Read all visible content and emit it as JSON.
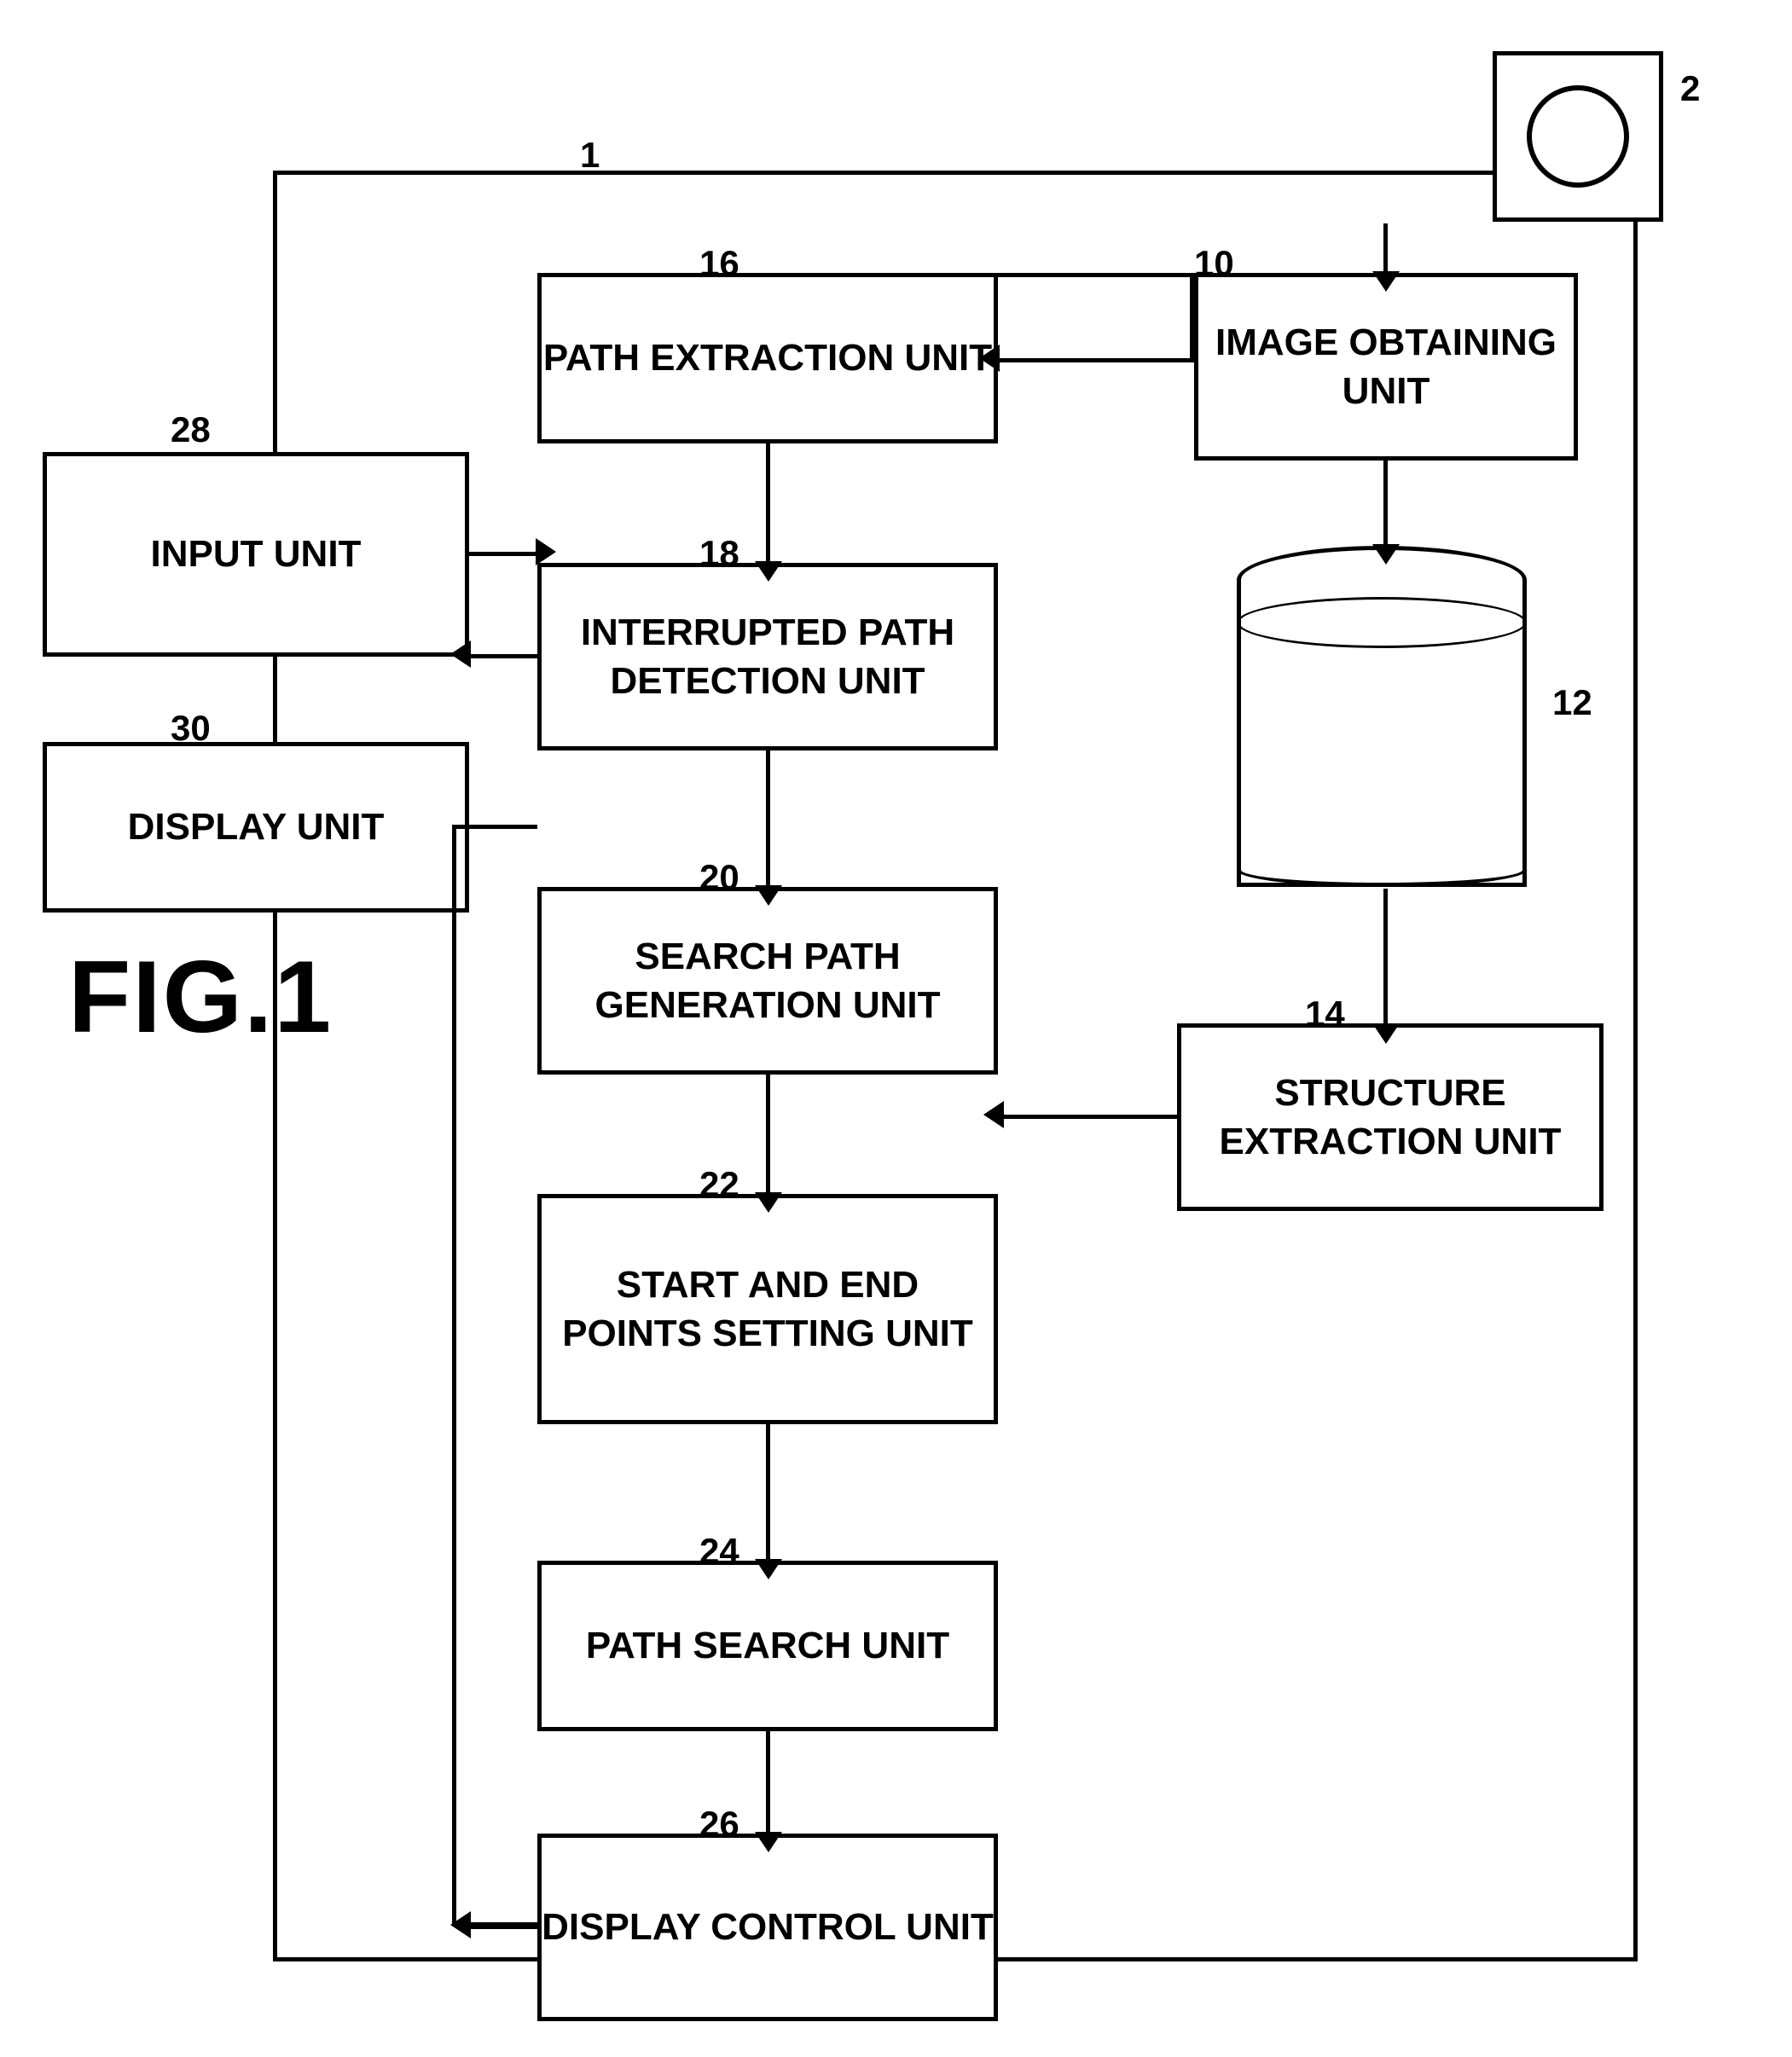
{
  "diagram": {
    "title": "FIG.1",
    "labels": {
      "camera": "2",
      "main_system": "1",
      "image_obtaining": "10",
      "database": "12",
      "structure_extraction": "14",
      "path_extraction": "16",
      "interrupted_path": "18",
      "search_path_gen": "20",
      "start_end_points": "22",
      "path_search": "24",
      "display_control": "26",
      "input_unit": "28",
      "display_unit": "30"
    },
    "blocks": {
      "input_unit": "INPUT UNIT",
      "display_unit": "DISPLAY UNIT",
      "image_obtaining": "IMAGE OBTAINING UNIT",
      "structure_extraction": "STRUCTURE EXTRACTION UNIT",
      "path_extraction": "PATH EXTRACTION UNIT",
      "interrupted_path": "INTERRUPTED PATH DETECTION UNIT",
      "search_path_gen": "SEARCH PATH GENERATION UNIT",
      "start_end_points": "START AND END POINTS SETTING UNIT",
      "path_search": "PATH SEARCH UNIT",
      "display_control": "DISPLAY CONTROL UNIT"
    }
  }
}
